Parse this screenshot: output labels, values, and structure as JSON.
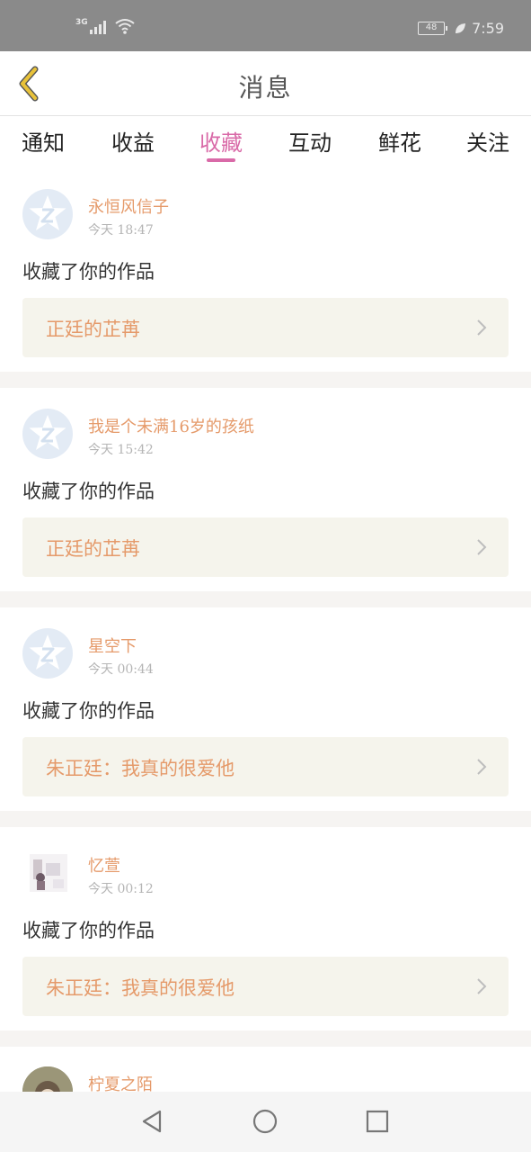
{
  "status_bar": {
    "network": "3G",
    "battery": "48",
    "time": "7:59"
  },
  "header": {
    "title": "消息"
  },
  "tabs": [
    {
      "label": "通知"
    },
    {
      "label": "收益"
    },
    {
      "label": "收藏",
      "active": true
    },
    {
      "label": "互动"
    },
    {
      "label": "鲜花"
    },
    {
      "label": "关注"
    }
  ],
  "colors": {
    "accent": "#d96aa8",
    "name": "#e59a6a",
    "card_bg": "#f5f4ec",
    "back_icon": "#e8c23a"
  },
  "messages": [
    {
      "user": "永恒风信子",
      "time": "今天 18:47",
      "action": "收藏了你的作品",
      "work": "正廷的芷苒",
      "avatar": "default-z-avatar"
    },
    {
      "user": "我是个未满16岁的孩纸",
      "time": "今天 15:42",
      "action": "收藏了你的作品",
      "work": "正廷的芷苒",
      "avatar": "default-z-avatar"
    },
    {
      "user": "星空下",
      "time": "今天 00:44",
      "action": "收藏了你的作品",
      "work": "朱正廷：我真的很爱他",
      "avatar": "default-z-avatar"
    },
    {
      "user": "忆萱",
      "time": "今天 00:12",
      "action": "收藏了你的作品",
      "work": "朱正廷：我真的很爱他",
      "avatar": "photo-avatar"
    },
    {
      "user": "柠夏之陌",
      "avatar": "photo-avatar"
    }
  ],
  "icons": {
    "back": "chevron-left-icon",
    "nav_back": "triangle-back-icon",
    "nav_home": "circle-home-icon",
    "nav_recent": "square-recent-icon"
  }
}
